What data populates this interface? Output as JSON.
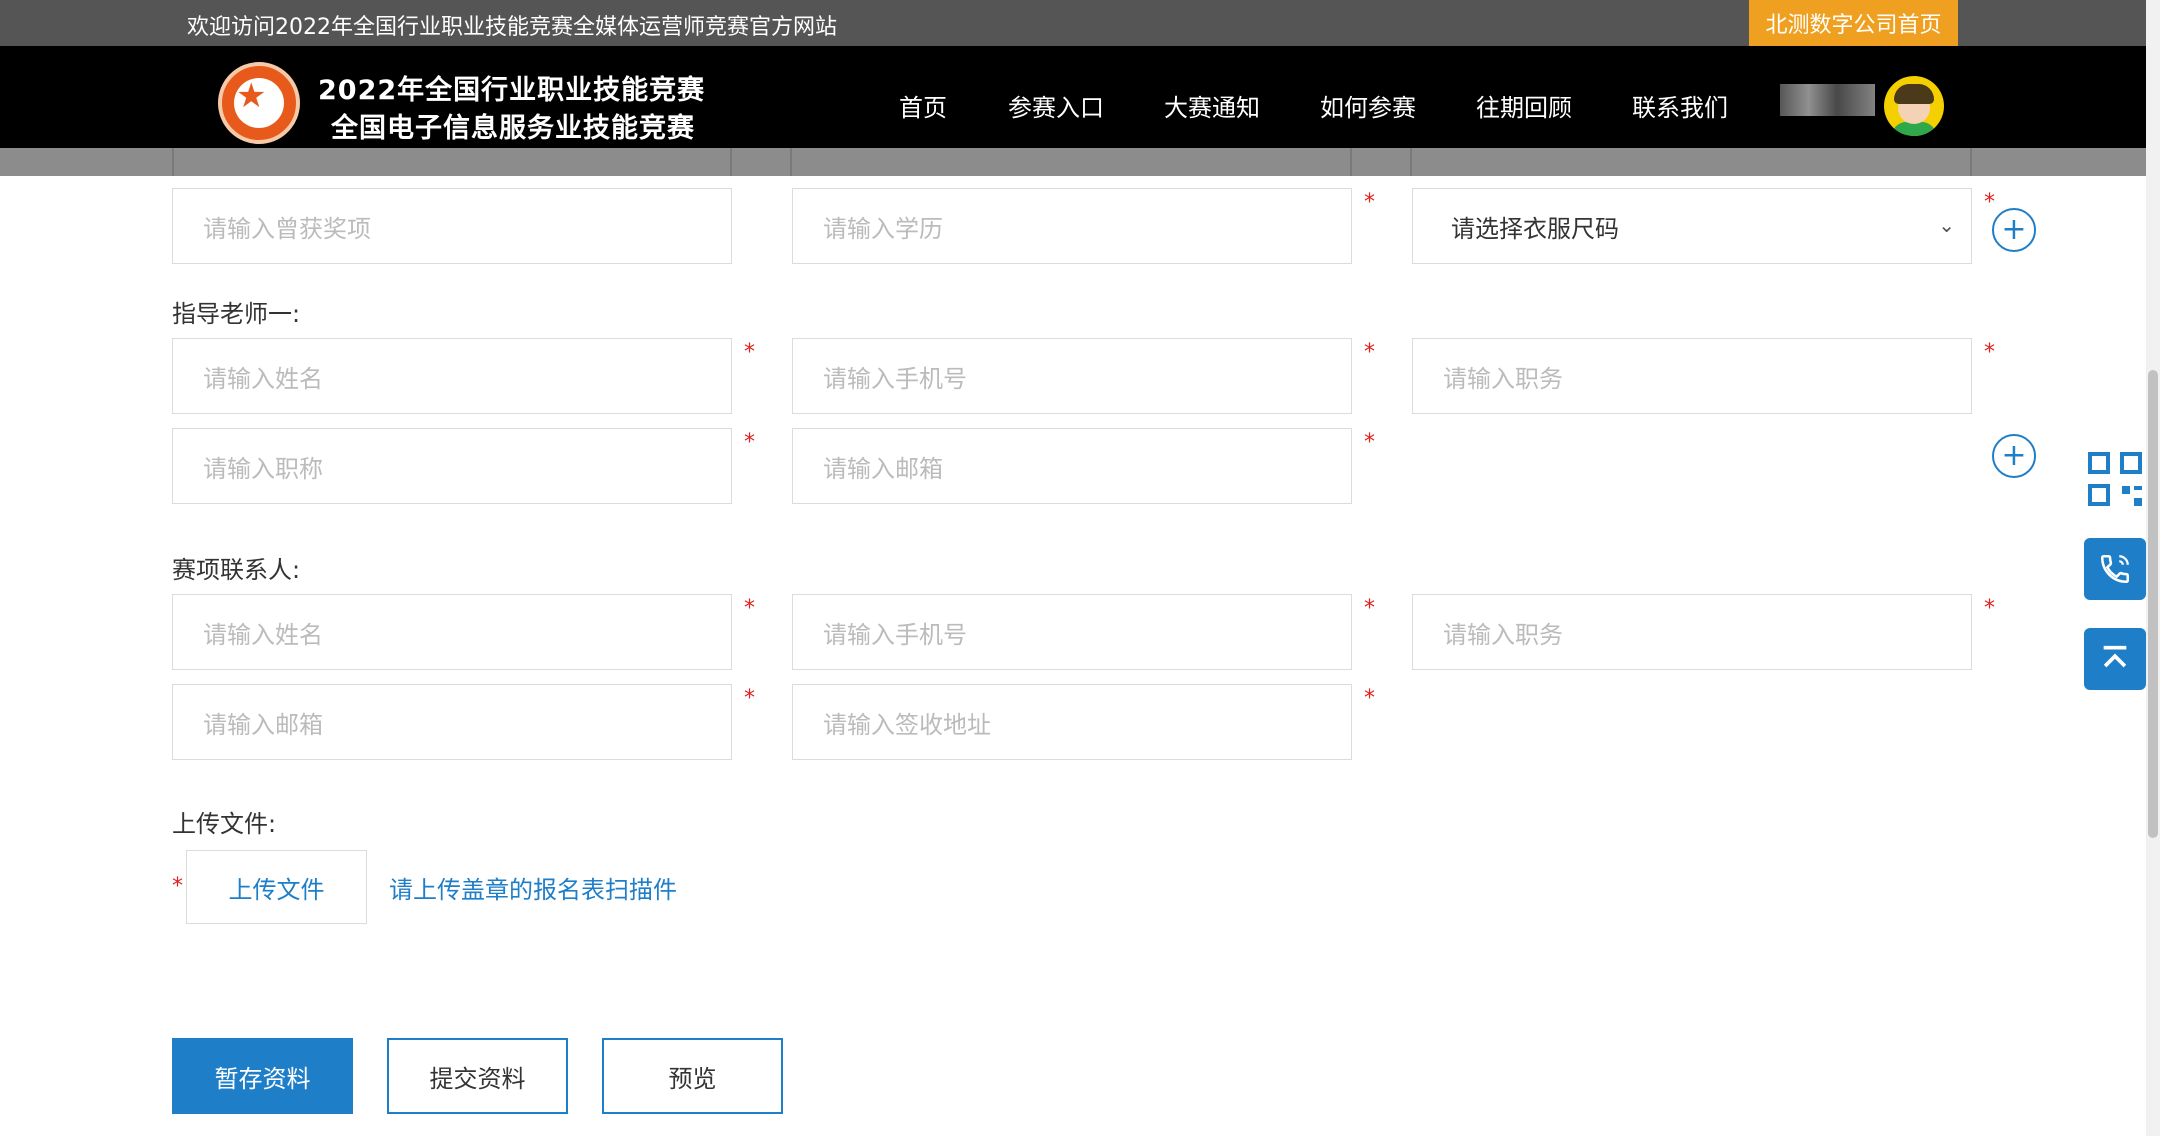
{
  "topbar": {
    "welcome": "欢迎访问2022年全国行业职业技能竞赛全媒体运营师竞赛官方网站",
    "company_link": "北测数字公司首页"
  },
  "header": {
    "title_line1": "2022年全国行业职业技能竞赛",
    "title_line2": "全国电子信息服务业技能竞赛",
    "nav": [
      "首页",
      "参赛入口",
      "大赛通知",
      "如何参赛",
      "往期回顾",
      "联系我们"
    ]
  },
  "form": {
    "row_awards": {
      "awards_placeholder": "请输入曾获奖项",
      "education_placeholder": "请输入学历",
      "size_select": "请选择衣服尺码"
    },
    "advisor": {
      "label": "指导老师一:",
      "name_placeholder": "请输入姓名",
      "phone_placeholder": "请输入手机号",
      "position_placeholder": "请输入职务",
      "title_placeholder": "请输入职称",
      "email_placeholder": "请输入邮箱"
    },
    "contact": {
      "label": "赛项联系人:",
      "name_placeholder": "请输入姓名",
      "phone_placeholder": "请输入手机号",
      "position_placeholder": "请输入职务",
      "email_placeholder": "请输入邮箱",
      "address_placeholder": "请输入签收地址"
    },
    "upload": {
      "label": "上传文件:",
      "button": "上传文件",
      "hint": "请上传盖章的报名表扫描件"
    },
    "required_mark": "*",
    "add_symbol": "+"
  },
  "actions": {
    "save": "暂存资料",
    "submit": "提交资料",
    "preview": "预览"
  },
  "colors": {
    "accent": "#1f7ec8",
    "orange": "#f0a020",
    "required": "#e02020"
  },
  "icons": [
    "qr-code-icon",
    "phone-icon",
    "back-to-top-icon",
    "chevron-down-icon",
    "plus-circle-icon"
  ]
}
